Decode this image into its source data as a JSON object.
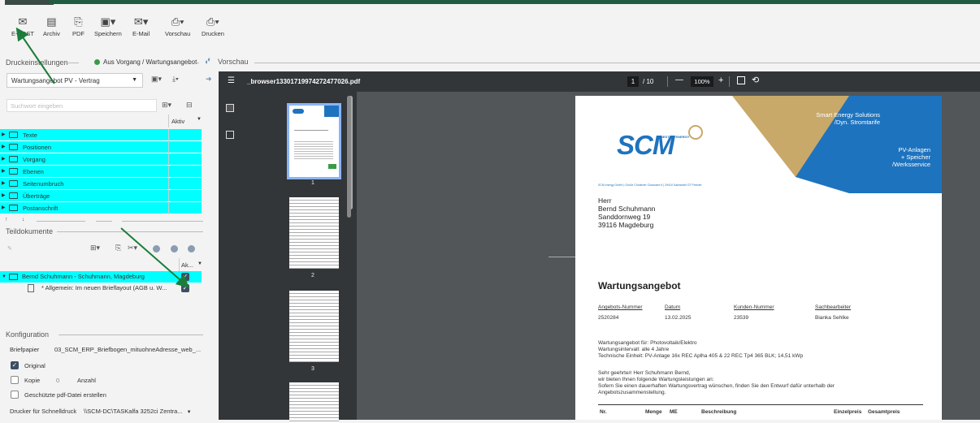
{
  "toolbar": {
    "items": [
      {
        "label": "E-POST",
        "icon": "envelope-icon"
      },
      {
        "label": "Archiv",
        "icon": "archive-icon"
      },
      {
        "label": "PDF",
        "icon": "pdf-icon"
      },
      {
        "label": "Speichern",
        "icon": "save-icon"
      },
      {
        "label": "E-Mail",
        "icon": "email-icon"
      },
      {
        "label": "Vorschau",
        "icon": "preview-icon"
      },
      {
        "label": "Drucken",
        "icon": "print-icon"
      }
    ]
  },
  "druck": {
    "title": "Druckeinstellungen",
    "source_label": "Aus Vorgang / Wartungsangebot",
    "template_value": "Wartungsangebot PV - Vertrag",
    "search_placeholder": "Suchwort eingeben",
    "aktiv_header": "Aktiv",
    "tree_items": [
      "Texte",
      "Positionen",
      "Vorgang",
      "Ebenen",
      "Seitenumbruch",
      "Überträge",
      "Postanschrift"
    ]
  },
  "teil": {
    "title": "Teildokumente",
    "ak_header": "Ak...",
    "rows": [
      {
        "label": "Bernd Schuhmann - Schuhmann, Magdeburg",
        "checked": true
      },
      {
        "label": "* Allgemein: Im neuen Brieflayout (AGB u. W...",
        "checked": true
      }
    ]
  },
  "konfig": {
    "title": "Konfiguration",
    "briefpapier_label": "Briefpapier",
    "briefpapier_value": "03_SCM_ERP_Briefbogen_mituohneAdresse_web_...",
    "original_label": "Original",
    "kopie_label": "Kopie",
    "kopie_count": "0",
    "anzahl_label": "Anzahl",
    "geschuetzt_label": "Geschützte pdf-Datei erstellen",
    "drucker_label": "Drucker für Schnelldruck",
    "drucker_value": "\\\\SCM-DC\\TASKalfa 3252ci Zentra..."
  },
  "vorschau": {
    "title": "Vorschau",
    "filename": "_browser13301719974272477026.pdf",
    "page_current": "1",
    "page_total": "/ 10",
    "zoom": "100%",
    "thumb_numbers": [
      "1",
      "2",
      "3"
    ]
  },
  "pdf": {
    "banner_text_1": "Smart Energy Solutions",
    "banner_text_2": "/Dyn. Stromtarife",
    "banner_text_3": "PV-Anlagen",
    "banner_text_4": "+ Speicher",
    "banner_text_5": "/Werksservice",
    "logo_text": "SCM",
    "logo_sub": "BEST OF ENERGY",
    "sender_line": "SCM energy GmbH | Große Chüdener Chaussee 6 | 29410 Salzwedel OT Pretzier",
    "recipient": [
      "Herr",
      "Bernd Schuhmann",
      "Sanddornweg 19",
      "39116 Magdeburg"
    ],
    "heading": "Wartungsangebot",
    "meta_headers": [
      "Angebots-Nummer",
      "Datum",
      "Kunden-Nummer",
      "Sachbearbeiter"
    ],
    "meta_values": [
      "2520284",
      "13.02.2025",
      "23539",
      "Bianka Sehlke"
    ],
    "body_1": "Wartungsangebot für: Photovoltaik/Elektro",
    "body_2": "Wartungsintervall: alle 4 Jahre",
    "body_3": "Technische Einheit: PV-Anlage 16x REC Aplha 405 & 22 REC Tp4 365 BLK; 14,51 kWp",
    "body_4": "Sehr geehrte/r Herr  Schuhmann Bernd,",
    "body_5": "wir bieten Ihnen folgende Wartungsleistungen an:",
    "body_6": "Sofern Sie einen dauerhaften Wartungsvertrag wünschen, finden Sie den Entwurf dafür unterhalb der",
    "body_7": "Angebotszusammenstellung.",
    "table_headers": [
      "Nr.",
      "Menge",
      "ME",
      "Beschreibung",
      "Einzelpreis",
      "Gesamtpreis"
    ]
  },
  "colors": {
    "accent": "#00ffff",
    "gold": "#c8a96a",
    "blue": "#1e73be",
    "arrow": "#1b7d3a"
  }
}
